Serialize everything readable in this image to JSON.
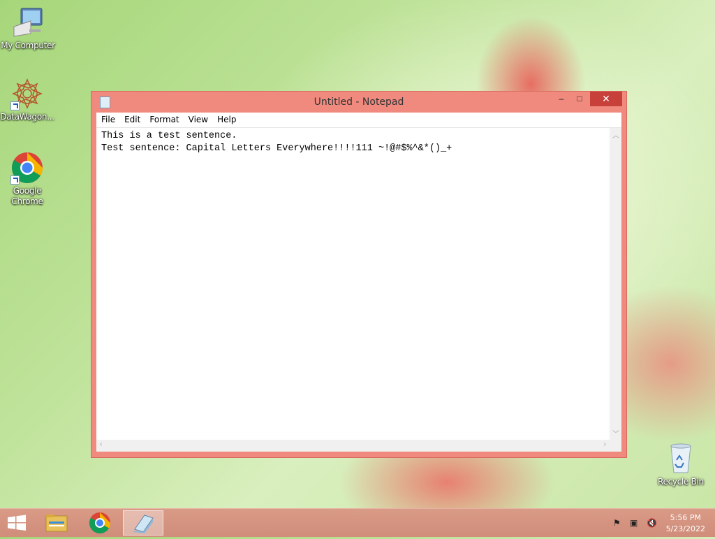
{
  "desktop": {
    "icons": [
      {
        "label": "My Computer"
      },
      {
        "label": "DataWagon..."
      },
      {
        "label": "Google Chrome"
      },
      {
        "label": "Recycle Bin"
      }
    ]
  },
  "window": {
    "title": "Untitled - Notepad",
    "menu": [
      "File",
      "Edit",
      "Format",
      "View",
      "Help"
    ],
    "content": "This is a test sentence.\nTest sentence: Capital Letters Everywhere!!!!111 ~!@#$%^&*()_+",
    "buttons": {
      "minimize": "–",
      "maximize": "□",
      "close": "✕"
    }
  },
  "taskbar": {
    "items": [
      "start-icon",
      "file-explorer-icon",
      "chrome-icon",
      "notepad-icon"
    ],
    "clock": {
      "time": "5:56 PM",
      "date": "5/23/2022"
    }
  },
  "colors": {
    "window_frame": "#f08a7e",
    "taskbar": "#d4927f",
    "close_button": "#c7403a"
  }
}
